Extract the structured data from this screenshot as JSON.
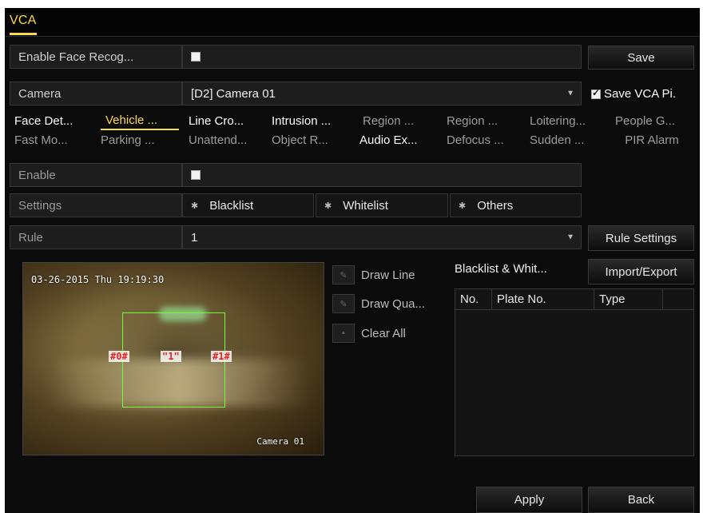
{
  "title_tab": "VCA",
  "face_recognition": {
    "label": "Enable Face Recog...",
    "checked": false
  },
  "save_button": "Save",
  "camera": {
    "label": "Camera",
    "value": "[D2] Camera 01"
  },
  "save_vca_picture": {
    "label": "Save VCA Pi.",
    "checked": true
  },
  "tabs_row1": [
    "Face Det...",
    "Vehicle ...",
    "Line Cro...",
    "Intrusion ...",
    "Region ...",
    "Region ...",
    "Loitering...",
    "People G..."
  ],
  "tabs_row2": [
    "Fast Mo...",
    "Parking ...",
    "Unattend...",
    "Object R...",
    "Audio Ex...",
    "Defocus ...",
    "Sudden ...",
    "PIR Alarm"
  ],
  "enable": {
    "label": "Enable",
    "checked": false
  },
  "settings": {
    "label": "Settings",
    "blacklist": "Blacklist",
    "whitelist": "Whitelist",
    "others": "Others"
  },
  "rule": {
    "label": "Rule",
    "value": "1",
    "settings_button": "Rule Settings"
  },
  "video": {
    "osd_time": "03-26-2015 Thu 19:19:30",
    "osd_camera": "Camera 01",
    "lane_labels": [
      "#0#",
      "\"1\"",
      "#1#"
    ]
  },
  "tools": {
    "draw_line": "Draw Line",
    "draw_quad": "Draw Qua...",
    "clear_all": "Clear All"
  },
  "blacklist_panel": {
    "title": "Blacklist & Whit...",
    "import_export": "Import/Export",
    "columns": [
      "No.",
      "Plate No.",
      "Type"
    ]
  },
  "footer": {
    "apply": "Apply",
    "back": "Back"
  }
}
